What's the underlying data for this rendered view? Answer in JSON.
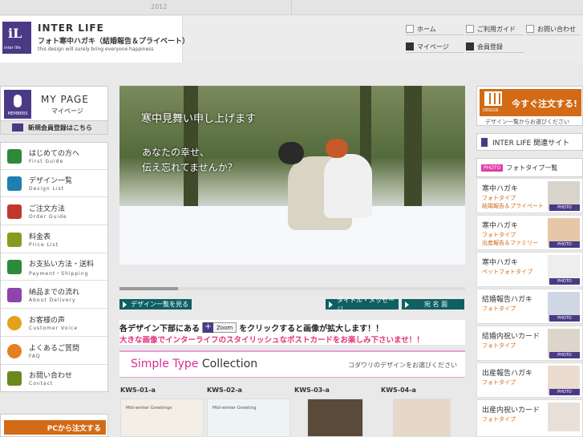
{
  "topbar": {
    "year": "2012"
  },
  "logo": {
    "mark": "iL",
    "mark_small": "inter life",
    "title": "INTER LIFE",
    "subtitle": "フォト寒中ハガキ（結婚報告＆プライベート）",
    "tagline": "this design will surely bring everyone happiness"
  },
  "header_nav": {
    "home": "ホーム",
    "guide": "ご利用ガイド",
    "contact": "お問い合わせ",
    "mypage": "マイページ",
    "register": "会員登録"
  },
  "left": {
    "mypage_title": "MY PAGE",
    "mypage_sub": "マイページ",
    "members_label": "MEMBERS",
    "register_label": "新規会員登録はこちら",
    "nav": [
      {
        "jp": "はじめての方へ",
        "en": "First Guide",
        "color": "#2d8a3a"
      },
      {
        "jp": "デザイン一覧",
        "en": "Design List",
        "color": "#1e7fb0"
      },
      {
        "jp": "ご注文方法",
        "en": "Order Guide",
        "color": "#c0392b"
      },
      {
        "jp": "料金表",
        "en": "Price List",
        "color": "#8a9a1e"
      },
      {
        "jp": "お支払い方法・送料",
        "en": "Payment・Shipping",
        "color": "#2d8a3a"
      },
      {
        "jp": "納品までの流れ",
        "en": "About Delivery",
        "color": "#8e44ad"
      },
      {
        "jp": "お客様の声",
        "en": "Customer Voice",
        "color": "#e3a21a"
      },
      {
        "jp": "よくあるご質問",
        "en": "FAQ",
        "color": "#e67e22"
      },
      {
        "jp": "お問い合わせ",
        "en": "Contact",
        "color": "#6a8a1e"
      }
    ],
    "pc_order": "PCから注文する"
  },
  "hero": {
    "headline": "寒中見舞い申し上げます",
    "message_line1": "あなたの幸せ、",
    "message_line2": "伝え忘れてませんか？"
  },
  "slider_progress": 0.17,
  "buttons": {
    "design_list": "デザイン一覧を見る",
    "title_message": "タイトル・メッセージ",
    "address": "宛 名 面"
  },
  "instructions": {
    "before_zoom": "各デザイン下部にある",
    "zoom_label": "Zoom",
    "after_zoom": "をクリックすると画像が拡大します！！",
    "line2": "大きな画像でインターライフのスタイリッシュなポストカードをお楽しみ下さいませ！！"
  },
  "collection": {
    "title_pink": "Simple Type",
    "title_rest": " Collection",
    "note": "コダワリのデザインをお選びください"
  },
  "designs": [
    {
      "code": "KWS-01-a",
      "caption": "Mid-winter Greetings"
    },
    {
      "code": "KWS-02-a",
      "caption": "Mid-winter Greeting"
    },
    {
      "code": "KWS-03-a",
      "caption": ""
    },
    {
      "code": "KWS-04-a",
      "caption": ""
    }
  ],
  "right": {
    "order_label": "今すぐ注文する!",
    "design_tag": "DESIGN",
    "order_sub": "デザイン一覧からお選びください",
    "related": "INTER LIFE 関連サイト",
    "photo_tag": "PHOTO",
    "photo_list": "フォトタイプ一覧",
    "photo_badge": "PHOTO",
    "cards": [
      {
        "t1": "寒中ハガキ",
        "t2": "フォトタイプ",
        "t3": "結婚報告＆プライベート"
      },
      {
        "t1": "寒中ハガキ",
        "t2": "フォトタイプ",
        "t3": "出産報告＆ファミリー"
      },
      {
        "t1": "寒中ハガキ",
        "t2": "ペットフォトタイプ",
        "t3": ""
      },
      {
        "t1": "結婚報告ハガキ",
        "t2": "フォトタイプ",
        "t3": ""
      },
      {
        "t1": "結婚内祝いカード",
        "t2": "フォトタイプ",
        "t3": ""
      },
      {
        "t1": "出産報告ハガキ",
        "t2": "フォトタイプ",
        "t3": ""
      },
      {
        "t1": "出産内祝いカード",
        "t2": "フォトタイプ",
        "t3": ""
      }
    ]
  }
}
